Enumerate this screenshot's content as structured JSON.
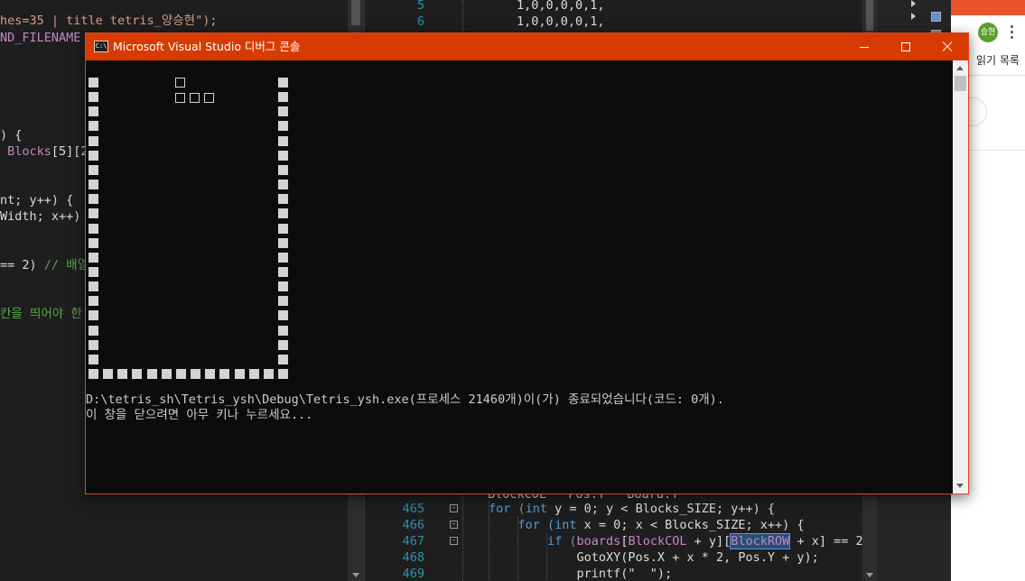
{
  "left_editor": {
    "lines": [
      {
        "parts": [
          {
            "text": "hes=35 | title tetris_양승현\");",
            "cls": "c-str"
          }
        ]
      },
      {
        "parts": [
          {
            "text": "ND_FILENAME",
            "cls": "c-mac"
          }
        ]
      },
      {
        "parts": [
          {
            "text": ") {",
            "cls": "c-def"
          }
        ]
      },
      {
        "parts": [
          {
            "text": " Blocks",
            "cls": "c-mac"
          },
          {
            "text": "[5][2",
            "cls": "c-def"
          }
        ]
      },
      {
        "parts": [
          {
            "text": "nt; y++) {",
            "cls": "c-def"
          }
        ]
      },
      {
        "parts": [
          {
            "text": "Width; x++)",
            "cls": "c-def"
          }
        ]
      },
      {
        "parts": [
          {
            "text": "== 2) ",
            "cls": "c-def"
          },
          {
            "text": "// 배열",
            "cls": "c-cmt"
          }
        ]
      },
      {
        "parts": [
          {
            "text": "칸을 띄어야 한",
            "cls": "c-cmt"
          }
        ]
      }
    ]
  },
  "right_editor": {
    "top_lines": [
      {
        "num": "5",
        "code": "1,0,0,0,0,1,"
      },
      {
        "num": "6",
        "code": "1,0,0,0,0,1,"
      }
    ],
    "partial_line": "BlockCOL   Pos.Y   Board.Y",
    "bottom_lines": [
      {
        "num": "465",
        "fold": "⊟",
        "parts": [
          {
            "text": "for (",
            "cls": "c-key"
          },
          {
            "text": "int",
            "cls": "c-key"
          },
          {
            "text": " y = 0; y < Blocks_SIZE; y++) {",
            "cls": "c-def"
          }
        ]
      },
      {
        "num": "466",
        "fold": "⊟",
        "parts": [
          {
            "text": "    for (",
            "cls": "c-key"
          },
          {
            "text": "int",
            "cls": "c-key"
          },
          {
            "text": " x = 0; x < Blocks_SIZE; x++) {",
            "cls": "c-def"
          }
        ]
      },
      {
        "num": "467",
        "fold": "⊟",
        "parts": [
          {
            "text": "        if (",
            "cls": "c-key"
          },
          {
            "text": "boards",
            "cls": "c-var"
          },
          {
            "text": "[",
            "cls": "c-def"
          },
          {
            "text": "BlockCOL",
            "cls": "c-var"
          },
          {
            "text": " + y][",
            "cls": "c-def"
          },
          {
            "text": "BlockROW",
            "cls": "c-hl"
          },
          {
            "text": " + x] == 2)",
            "cls": "c-def"
          }
        ]
      },
      {
        "num": "468",
        "fold": "",
        "parts": [
          {
            "text": "            GotoXY(Pos.X + x * 2, Pos.Y + y);",
            "cls": "c-def"
          }
        ]
      },
      {
        "num": "469",
        "fold": "",
        "parts": [
          {
            "text": "            printf(\"  \");",
            "cls": "c-def"
          }
        ]
      }
    ]
  },
  "browser": {
    "avatar_text": "승현",
    "reading_text": "읽기 목록",
    "accent": "#e8542e",
    "avatar_color": "#5aa02c"
  },
  "console": {
    "title": "Microsoft Visual Studio 디버그 콘솔",
    "icon_text": "C:\\",
    "titlebar_color": "#d83b01",
    "buttons": {
      "minimize": "minimize-icon",
      "maximize": "maximize-icon",
      "close": "close-icon"
    },
    "output": [
      "D:\\tetris_sh\\Tetris_ysh\\Debug\\Tetris_ysh.exe(프로세스 21460개)이(가) 종료되었습니다(코드: 0개).",
      "이 창을 닫으려면 아무 키나 누르세요..."
    ],
    "board": {
      "wall_rows": 20,
      "floor_cells": 14,
      "piece_cells": [
        [
          6,
          0
        ],
        [
          6,
          1
        ],
        [
          7,
          1
        ],
        [
          8,
          1
        ]
      ]
    }
  }
}
